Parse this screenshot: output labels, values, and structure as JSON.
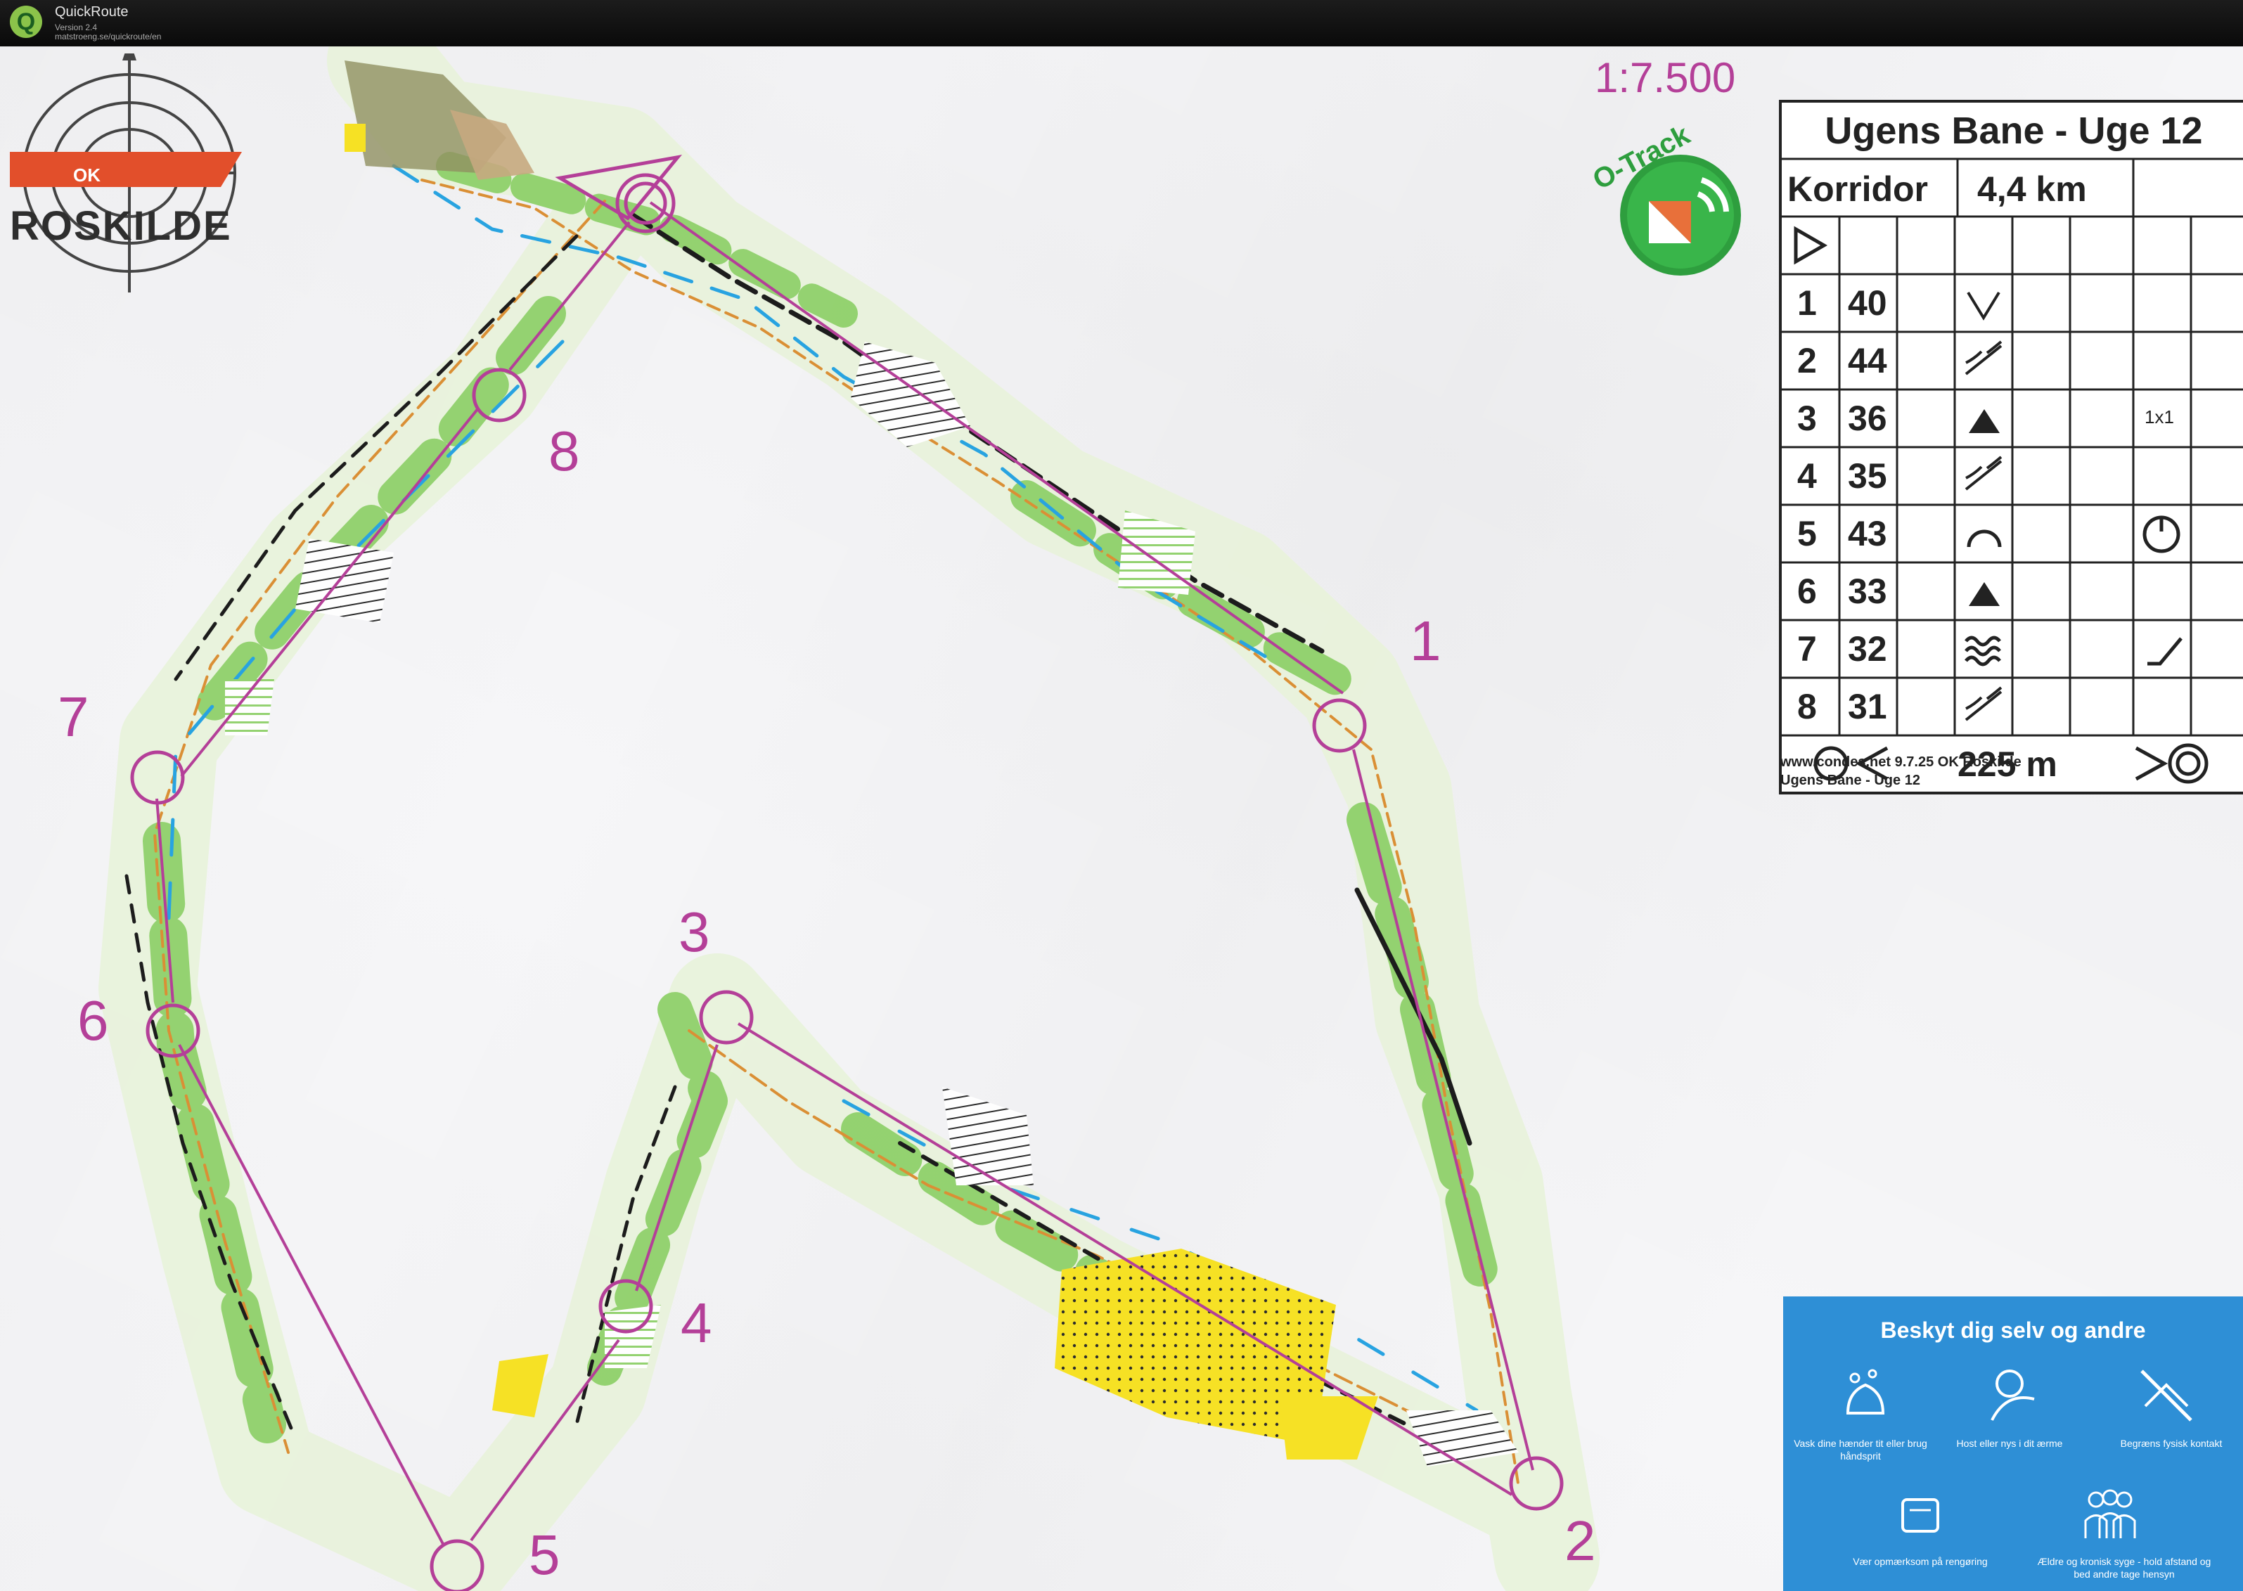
{
  "app": {
    "name": "QuickRoute",
    "version": "Version 2.4",
    "url": "matstroeng.se/quickroute/en"
  },
  "map": {
    "scale": "1:7.500",
    "club": "ROSKILDE",
    "logo_text": "OK",
    "o_track_label": "O-Track",
    "control_numbers": [
      "1",
      "2",
      "3",
      "4",
      "5",
      "6",
      "7",
      "8"
    ]
  },
  "description_sheet": {
    "title": "Ugens Bane - Uge 12",
    "class": "Korridor",
    "length": "4,4 km",
    "controls": [
      {
        "num": "1",
        "code": "40",
        "symbol": "v-valley",
        "extra": ""
      },
      {
        "num": "2",
        "code": "44",
        "symbol": "crossing",
        "extra": ""
      },
      {
        "num": "3",
        "code": "36",
        "symbol": "triangle",
        "extra": "1x1"
      },
      {
        "num": "4",
        "code": "35",
        "symbol": "crossing",
        "extra": ""
      },
      {
        "num": "5",
        "code": "43",
        "symbol": "knoll",
        "extra": "clock"
      },
      {
        "num": "6",
        "code": "33",
        "symbol": "triangle",
        "extra": ""
      },
      {
        "num": "7",
        "code": "32",
        "symbol": "marsh",
        "extra": "corner"
      },
      {
        "num": "8",
        "code": "31",
        "symbol": "crossing",
        "extra": ""
      }
    ],
    "finish_distance": "225 m",
    "footer_line1": "www.condes.net 9.7.25 OK Roskilde",
    "footer_line2": "Ugens Bane - Uge 12"
  },
  "notice": {
    "heading": "Beskyt dig selv og andre",
    "items": [
      "Vask dine hænder tit eller brug håndsprit",
      "Host eller nys i dit ærme",
      "Begræns fysisk kontakt",
      "Vær opmærksom på rengøring",
      "Ældre og kronisk syge - hold afstand og bed andre tage hensyn"
    ]
  },
  "colors": {
    "course": "#b43f98",
    "forest_green": "#8fd16a",
    "contour_brown": "#d98a2b",
    "water_blue": "#1e9fe0",
    "open_yellow": "#f7e11a",
    "notice_blue": "#2e8fd6"
  }
}
